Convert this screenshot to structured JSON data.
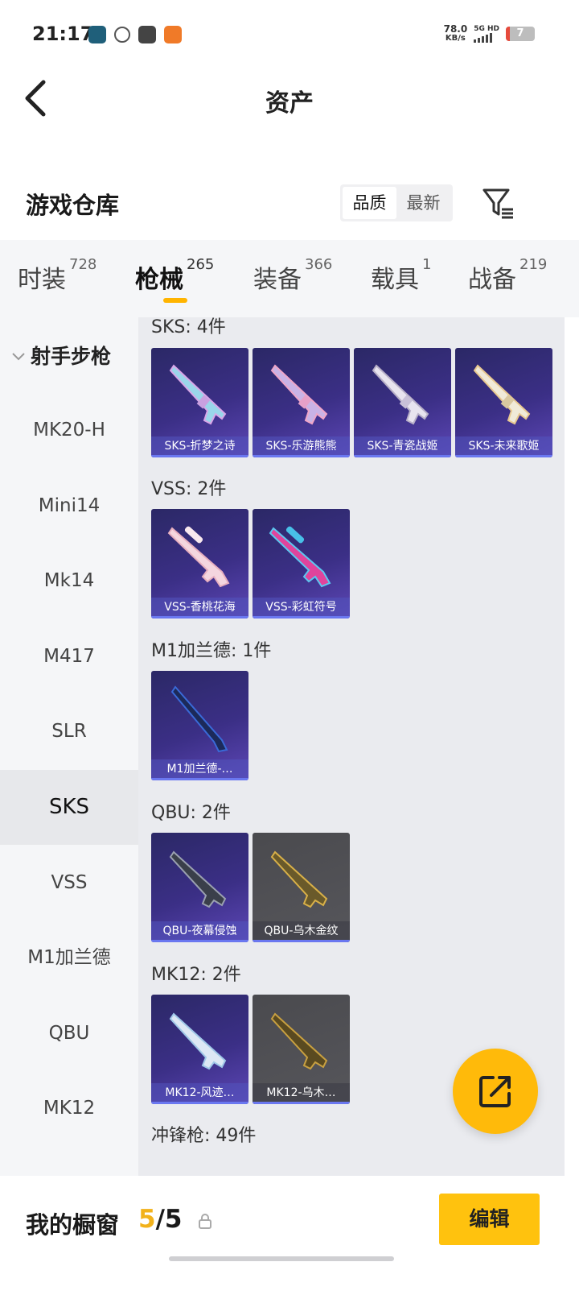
{
  "status_bar": {
    "time": "21:17",
    "net_speed": "78.0",
    "net_unit": "KB/s",
    "net_type": "5G HD",
    "battery": "7"
  },
  "header": {
    "title": "资产"
  },
  "section": {
    "title": "游戏仓库",
    "sort_options": [
      "品质",
      "最新"
    ],
    "active_sort": "品质"
  },
  "tabs": [
    {
      "label": "时装",
      "count": "728"
    },
    {
      "label": "枪械",
      "count": "265",
      "active": true
    },
    {
      "label": "装备",
      "count": "366"
    },
    {
      "label": "载具",
      "count": "1"
    },
    {
      "label": "战备",
      "count": "219"
    }
  ],
  "categories": {
    "group": "射手步枪",
    "items": [
      "MK20-H",
      "Mini14",
      "Mk14",
      "M417",
      "SLR",
      "SKS",
      "VSS",
      "M1加兰德",
      "QBU",
      "MK12"
    ],
    "active": "SKS"
  },
  "groups": [
    {
      "title": "SKS: 4件",
      "items": [
        "SKS-折梦之诗",
        "SKS-乐游熊熊",
        "SKS-青瓷战姬",
        "SKS-未来歌姬"
      ]
    },
    {
      "title": "VSS: 2件",
      "items": [
        "VSS-香桃花海",
        "VSS-彩虹符号"
      ]
    },
    {
      "title": "M1加兰德: 1件",
      "items": [
        "M1加兰德-…"
      ]
    },
    {
      "title": "QBU: 2件",
      "items": [
        "QBU-夜幕侵蚀",
        "QBU-乌木金纹"
      ]
    },
    {
      "title": "MK12: 2件",
      "items": [
        "MK12-风迹…",
        "MK12-乌木…"
      ]
    },
    {
      "title": "冲锋枪: 49件",
      "items": []
    }
  ],
  "bottom": {
    "showcase_label": "我的橱窗",
    "showcase_current": "5",
    "showcase_total": "/5",
    "edit_label": "编辑"
  },
  "colors": {
    "accent": "#ffc20e",
    "card_purple": "#3b2f86",
    "card_gray": "#56565b",
    "label_bar": "#6a77f0"
  }
}
